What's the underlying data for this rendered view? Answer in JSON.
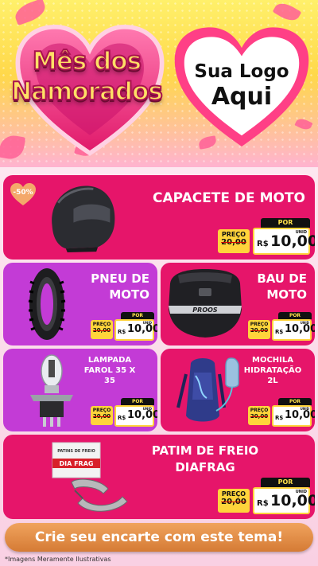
{
  "header": {
    "title_line1": "Mês dos",
    "title_line2": "Namorados",
    "logo_line1": "Sua Logo",
    "logo_line2": "Aqui",
    "colors": {
      "yellow": "#ffe066",
      "pink": "#e6156a",
      "purple": "#c33bd6",
      "heart_red": "#ff4f8b"
    }
  },
  "badge": "-50%",
  "products": [
    {
      "name": "CAPACETE DE MOTO",
      "icon": "helmet-icon",
      "por": "POR",
      "preco": "PREÇO",
      "old_price": "20,00",
      "currency": "R$",
      "price": "10,00",
      "unit": "UNID"
    },
    {
      "name_l1": "PNEU DE",
      "name_l2": "MOTO",
      "icon": "tire-icon",
      "por": "POR",
      "preco": "PREÇO",
      "old_price": "20,00",
      "currency": "R$",
      "price": "10,00",
      "unit": "UNID"
    },
    {
      "name_l1": "BAU DE",
      "name_l2": "MOTO",
      "icon": "topcase-icon",
      "brand": "PROOS",
      "por": "POR",
      "preco": "PREÇO",
      "old_price": "20,00",
      "currency": "R$",
      "price": "10,00",
      "unit": "UNID"
    },
    {
      "name_l1": "LAMPADA",
      "name_l2": "FAROL 35 X",
      "name_l3": "35",
      "icon": "bulb-icon",
      "por": "POR",
      "preco": "PREÇO",
      "old_price": "20,00",
      "currency": "R$",
      "price": "10,00",
      "unit": "UNID"
    },
    {
      "name_l1": "MOCHILA",
      "name_l2": "HIDRATAÇÃO",
      "name_l3": "2L",
      "icon": "backpack-icon",
      "por": "POR",
      "preco": "PREÇO",
      "old_price": "20,00",
      "currency": "R$",
      "price": "10,00",
      "unit": "UNID"
    },
    {
      "name_l1": "PATIM DE FREIO",
      "name_l2": "DIAFRAG",
      "icon": "brake-pads-icon",
      "box_label1": "PATINS DE FREIO",
      "box_brand": "DIA FRAG",
      "por": "POR",
      "preco": "PREÇO",
      "old_price": "20,00",
      "currency": "R$",
      "price": "10,00",
      "unit": "UNID"
    }
  ],
  "cta": "Crie seu encarte com este tema!",
  "disclaimer": "*Imagens Meramente Ilustrativas"
}
